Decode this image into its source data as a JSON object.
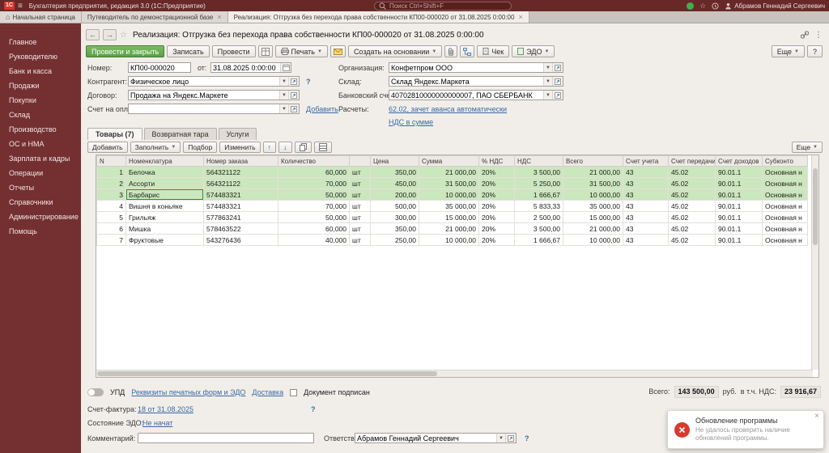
{
  "titlebar": {
    "logo": "1С",
    "app_title": "Бухгалтерия предприятия, редакция 3.0 (1С:Предприятие)",
    "search_placeholder": "Поиск Ctrl+Shift+F",
    "user": "Абрамов Геннадий Сергеевич"
  },
  "tabbar": {
    "tabs": [
      {
        "label": "Начальная страница"
      },
      {
        "label": "Путеводитель по демонстрационной базе"
      },
      {
        "label": "Реализация: Отгрузка без перехода права собственности КП00-000020 от 31.08.2025 0:00:00"
      }
    ]
  },
  "sidebar": {
    "items": [
      "Главное",
      "Руководителю",
      "Банк и касса",
      "Продажи",
      "Покупки",
      "Склад",
      "Производство",
      "ОС и НМА",
      "Зарплата и кадры",
      "Операции",
      "Отчеты",
      "Справочники",
      "Администрирование",
      "Помощь"
    ]
  },
  "doc": {
    "title": "Реализация: Отгрузка без перехода права собственности КП00-000020 от 31.08.2025 0:00:00",
    "toolbar": {
      "post_and_close": "Провести и закрыть",
      "save": "Записать",
      "post": "Провести",
      "print": "Печать",
      "create_on_base": "Создать на основании",
      "receipt": "Чек",
      "edo": "ЭДО",
      "more": "Еще",
      "help": "?"
    },
    "form": {
      "number_label": "Номер:",
      "number_value": "КП00-000020",
      "date_label": "от:",
      "date_value": "31.08.2025 0:00:00",
      "counterparty_label": "Контрагент:",
      "counterparty_value": "Физическое лицо",
      "counterparty_help": "?",
      "contract_label": "Договор:",
      "contract_value": "Продажа на Яндекс.Маркете",
      "invoice_label": "Счет на оплату:",
      "invoice_value": "",
      "invoice_add_link": "Добавить",
      "organization_label": "Организация:",
      "organization_value": "Конфетпром ООО",
      "warehouse_label": "Склад:",
      "warehouse_value": "Склад Яндекс.Маркета",
      "bank_account_label": "Банковский счет:",
      "bank_account_value": "40702810000000000007, ПАО СБЕРБАНК",
      "settlements_label": "Расчеты:",
      "settlements_link": "62.02, зачет аванса автоматически",
      "vat_link": "НДС в сумме"
    },
    "grid_tabs": [
      "Товары (7)",
      "Возвратная тара",
      "Услуги"
    ],
    "grid_toolbar": {
      "add": "Добавить",
      "fill": "Заполнить",
      "pick": "Подбор",
      "edit": "Изменить",
      "more": "Еще"
    },
    "table": {
      "columns": [
        "N",
        "Номенклатура",
        "Номер заказа",
        "Количество",
        "",
        "Цена",
        "Сумма",
        "% НДС",
        "НДС",
        "Всего",
        "Счет учета",
        "Счет передачи",
        "Счет доходов",
        "Субконто"
      ],
      "rows": [
        [
          "1",
          "Белочка",
          "564321122",
          "60,000",
          "шт",
          "350,00",
          "21 000,00",
          "20%",
          "3 500,00",
          "21 000,00",
          "43",
          "45.02",
          "90.01.1",
          "Основная н"
        ],
        [
          "2",
          "Ассорти",
          "564321122",
          "70,000",
          "шт",
          "450,00",
          "31 500,00",
          "20%",
          "5 250,00",
          "31 500,00",
          "43",
          "45.02",
          "90.01.1",
          "Основная н"
        ],
        [
          "3",
          "Барбарис",
          "574483321",
          "50,000",
          "шт",
          "200,00",
          "10 000,00",
          "20%",
          "1 666,67",
          "10 000,00",
          "43",
          "45.02",
          "90.01.1",
          "Основная н"
        ],
        [
          "4",
          "Вишня в коньяке",
          "574483321",
          "70,000",
          "шт",
          "500,00",
          "35 000,00",
          "20%",
          "5 833,33",
          "35 000,00",
          "43",
          "45.02",
          "90.01.1",
          "Основная н"
        ],
        [
          "5",
          "Грильяж",
          "577863241",
          "50,000",
          "шт",
          "300,00",
          "15 000,00",
          "20%",
          "2 500,00",
          "15 000,00",
          "43",
          "45.02",
          "90.01.1",
          "Основная н"
        ],
        [
          "6",
          "Мишка",
          "578463522",
          "60,000",
          "шт",
          "350,00",
          "21 000,00",
          "20%",
          "3 500,00",
          "21 000,00",
          "43",
          "45.02",
          "90.01.1",
          "Основная н"
        ],
        [
          "7",
          "Фруктовые",
          "543276436",
          "40,000",
          "шт",
          "250,00",
          "10 000,00",
          "20%",
          "1 666,67",
          "10 000,00",
          "43",
          "45.02",
          "90.01.1",
          "Основная н"
        ]
      ],
      "highlighted_rows": [
        0,
        1,
        2
      ],
      "selected_cell": {
        "row": 2,
        "col": 1
      }
    },
    "footer": {
      "upd": "УПД",
      "print_forms_link": "Реквизиты печатных форм и ЭДО",
      "delivery_link": "Доставка",
      "signed_checkbox": "Документ подписан",
      "total_label": "Всего:",
      "total_value": "143 500,00",
      "currency": "руб.",
      "vat_total_label": "в т.ч. НДС:",
      "vat_total_value": "23 916,67",
      "invoice_label": "Счет-фактура:",
      "invoice_link": "18 от 31.08.2025",
      "invoice_help": "?",
      "edo_state_label": "Состояние ЭДО:",
      "edo_state_link": "Не начат",
      "comment_label": "Комментарий:",
      "comment_value": "",
      "responsible_label": "Ответственный:",
      "responsible_value": "Абрамов Геннадий Сергеевич",
      "responsible_help": "?"
    }
  },
  "notification": {
    "title": "Обновление программы",
    "message": "Не удалось проверить наличие обновлений программы.",
    "close": "×"
  }
}
